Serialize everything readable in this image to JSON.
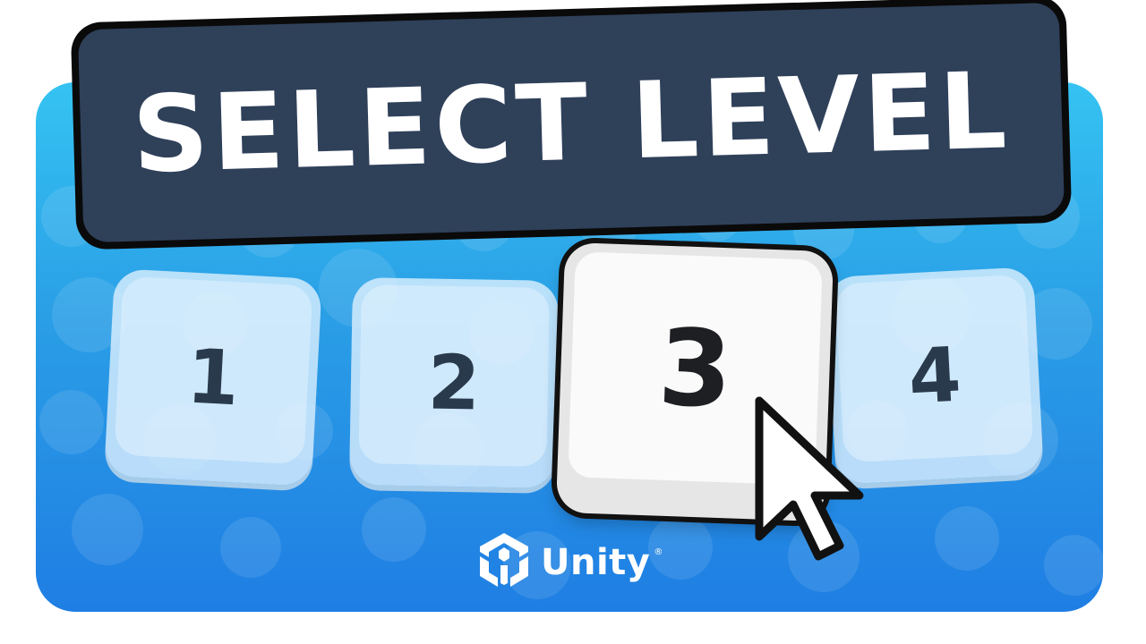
{
  "title": "SELECT LEVEL",
  "levels": [
    {
      "label": "1",
      "selected": false
    },
    {
      "label": "2",
      "selected": false
    },
    {
      "label": "3",
      "selected": true
    },
    {
      "label": "4",
      "selected": false
    }
  ],
  "brand": {
    "name": "Unity",
    "mark": "®"
  },
  "colors": {
    "background_top": "#35c3f2",
    "background_bottom": "#1f7ee3",
    "title_bar": "#2f4059",
    "title_text": "#ffffff",
    "key_inactive": "#e1f2ff",
    "key_active": "#fafafa",
    "key_text": "#2a3a4d"
  },
  "icons": [
    "unity-logo-icon",
    "mouse-cursor-icon"
  ]
}
